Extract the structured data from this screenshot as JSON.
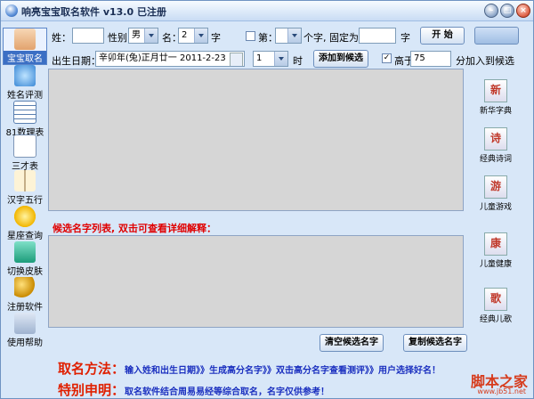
{
  "window": {
    "title": "响亮宝宝取名软件 v13.0  已注册"
  },
  "titlebar_buttons": [
    "minimize-icon",
    "maximize-icon",
    "close-icon"
  ],
  "sidebar": {
    "items": [
      {
        "label": "宝宝取名",
        "icon": "baby-icon",
        "active": true
      },
      {
        "label": "姓名评测",
        "icon": "name-test-icon"
      },
      {
        "label": "81数理表",
        "icon": "table-icon"
      },
      {
        "label": "三才表",
        "icon": "document-icon"
      },
      {
        "label": "汉字五行",
        "icon": "book-icon"
      },
      {
        "label": "星座查询",
        "icon": "star-icon"
      },
      {
        "label": "切换皮肤",
        "icon": "skin-icon"
      },
      {
        "label": "注册软件",
        "icon": "key-icon"
      },
      {
        "label": "使用帮助",
        "icon": "help-icon"
      }
    ]
  },
  "form": {
    "surname_label": "姓：",
    "surname_value": "",
    "gender_label": "性别",
    "gender_value": "男",
    "name_label": "名：",
    "name_count_value": "2",
    "char_label": "字",
    "position_label": "第：",
    "position_value": "",
    "fixed_label": "个字, 固定为：",
    "fixed_value": "",
    "fixed_char_label": "字",
    "start_button": "开  始",
    "blank_button": "",
    "birthdate_label": "出生日期：",
    "birthdate_value": "辛卯年(兔)正月廿一  2011-2-23",
    "hour_value": "1",
    "hour_label": "时",
    "add_candidate_button": "添加到候选",
    "above_checked": true,
    "above_label": "高于",
    "above_value": "75",
    "above_suffix": "分加入到候选"
  },
  "candidate_hint": "候选名字列表, 双击可查看详细解释：",
  "buttons": {
    "clear_candidates": "清空候选名字",
    "copy_candidates": "复制候选名字"
  },
  "tools": [
    {
      "glyph": "新",
      "label": "新华字典",
      "icon": "dictionary-icon"
    },
    {
      "glyph": "诗",
      "label": "经典诗词",
      "icon": "poetry-icon"
    },
    {
      "glyph": "游",
      "label": "儿童游戏",
      "icon": "games-icon"
    },
    {
      "glyph": "康",
      "label": "儿童健康",
      "icon": "health-icon"
    },
    {
      "glyph": "歌",
      "label": "经典儿歌",
      "icon": "songs-icon"
    }
  ],
  "footer": {
    "method_key": "取名方法：",
    "method_text": "输入姓和出生日期》》生成高分名字》》双击高分名字查看测评》》用户选择好名！",
    "notice_key": "特别申明：",
    "notice_text": "取名软件结合周易易经等综合取名，名字仅供参考！"
  },
  "watermark": {
    "text": "脚本之家",
    "url": "www.jb51.net"
  },
  "colors": {
    "accent": "#3b6fc4",
    "warning": "#e00000",
    "footer_text": "#1a2fbf",
    "panel": "#d6d6d6"
  }
}
